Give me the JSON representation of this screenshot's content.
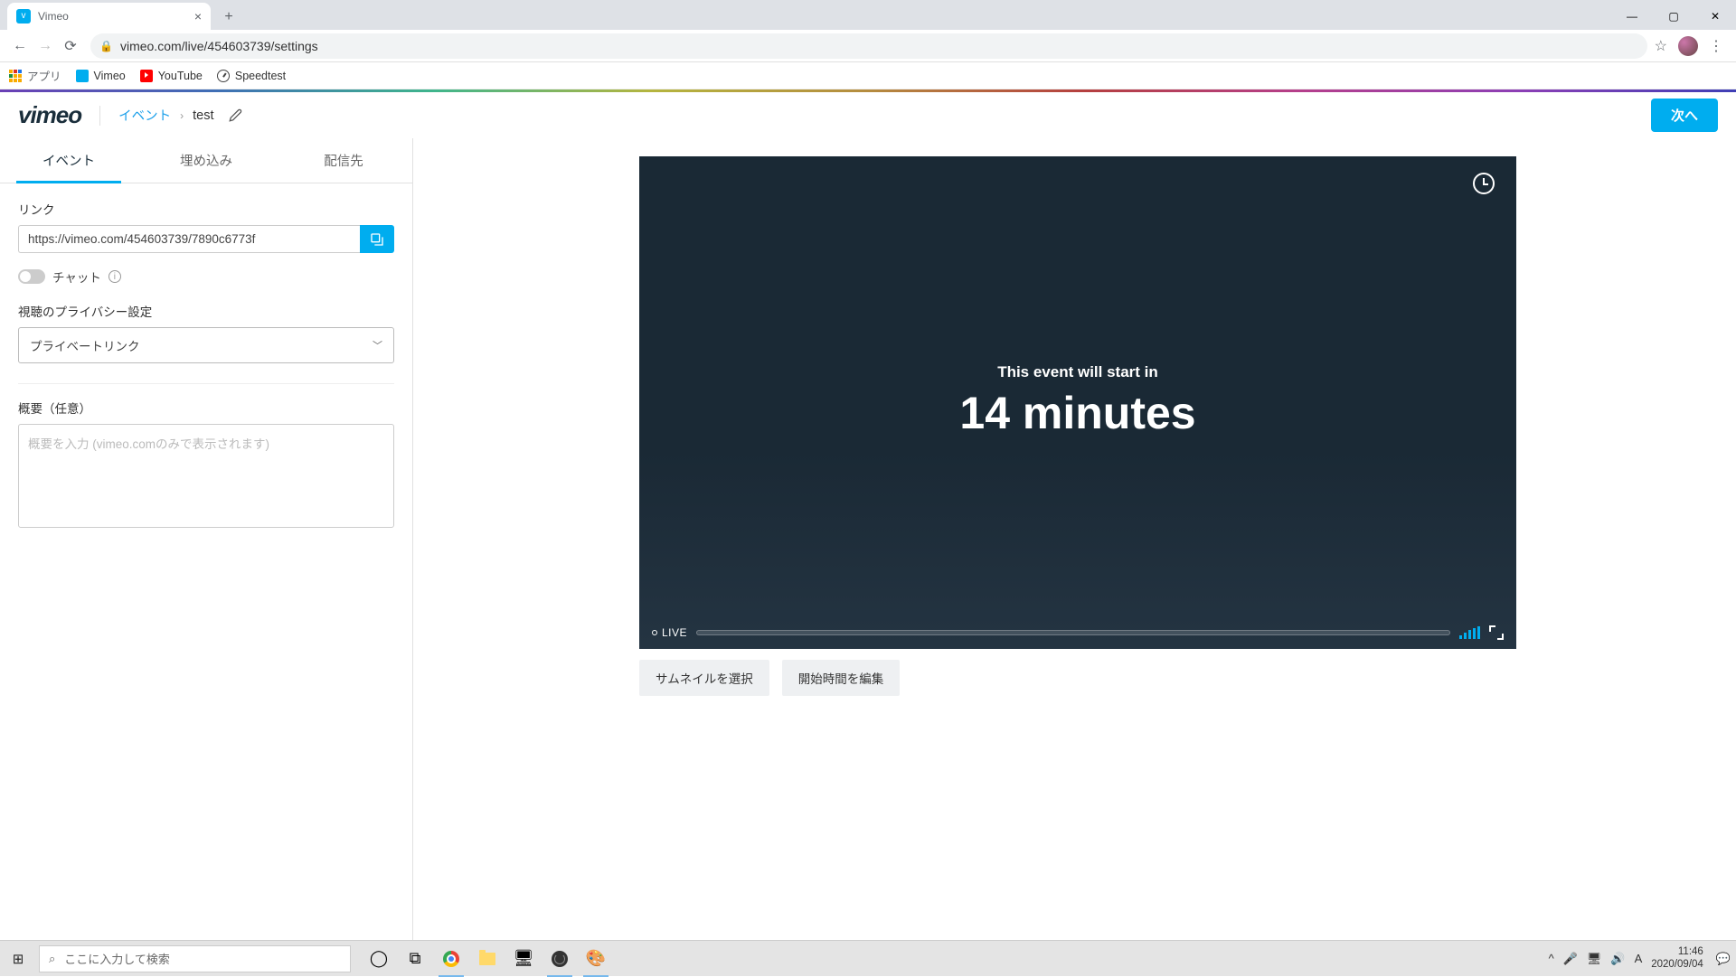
{
  "browser": {
    "tab_title": "Vimeo",
    "url": "vimeo.com/live/454603739/settings",
    "bookmarks": {
      "apps": "アプリ",
      "vimeo": "Vimeo",
      "youtube": "YouTube",
      "speedtest": "Speedtest"
    }
  },
  "header": {
    "logo": "vimeo",
    "breadcrumb_root": "イベント",
    "breadcrumb_current": "test",
    "next_button": "次へ"
  },
  "tabs": {
    "event": "イベント",
    "embed": "埋め込み",
    "destinations": "配信先"
  },
  "panel": {
    "link_label": "リンク",
    "link_value": "https://vimeo.com/454603739/7890c6773f",
    "chat_label": "チャット",
    "privacy_label": "視聴のプライバシー設定",
    "privacy_value": "プライベートリンク",
    "description_label": "概要（任意）",
    "description_placeholder": "概要を入力 (vimeo.comのみで表示されます)"
  },
  "player": {
    "countdown_msg": "This event will start in",
    "countdown_time": "14 minutes",
    "live_label": "LIVE"
  },
  "buttons": {
    "thumbnail": "サムネイルを選択",
    "starttime": "開始時間を編集"
  },
  "taskbar": {
    "search_placeholder": "ここに入力して検索",
    "time": "11:46",
    "date": "2020/09/04",
    "ime": "A"
  }
}
